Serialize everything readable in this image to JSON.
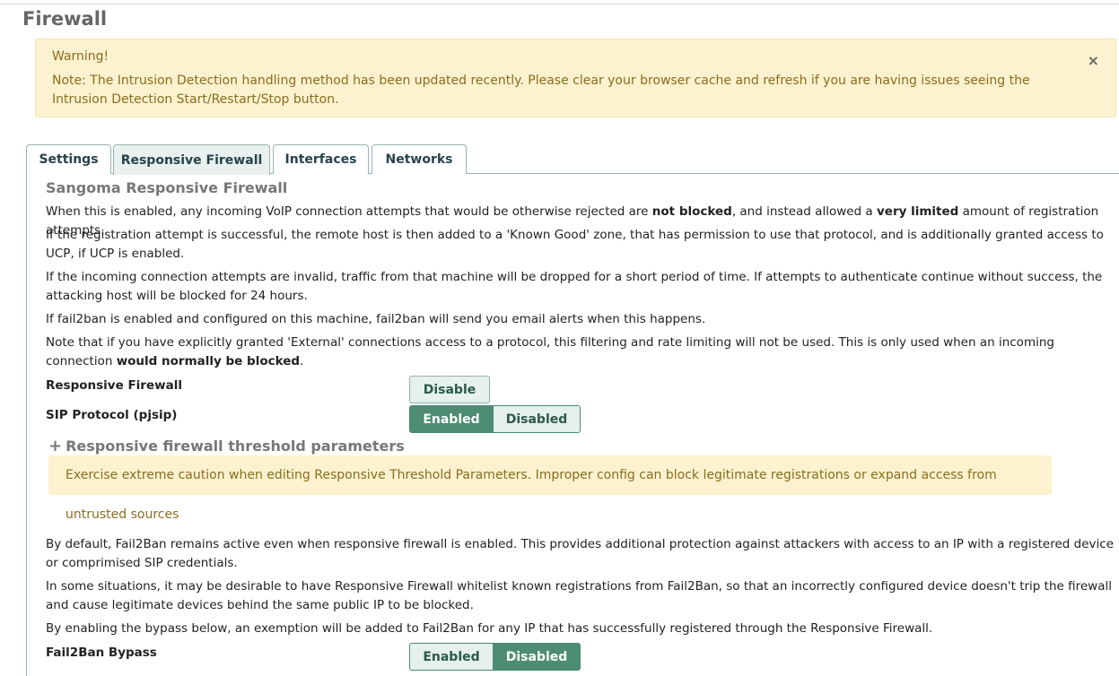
{
  "page": {
    "title": "Firewall"
  },
  "warning": {
    "title": "Warning!",
    "body": "Note: The Intrusion Detection handling method has been updated recently. Please clear your browser cache and refresh if you are having issues seeing the Intrusion Detection Start/Restart/Stop button.",
    "close": "×"
  },
  "tabs": [
    {
      "label": "Settings"
    },
    {
      "label": "Responsive Firewall"
    },
    {
      "label": "Interfaces"
    },
    {
      "label": "Networks"
    }
  ],
  "section": {
    "title": "Sangoma Responsive Firewall",
    "p1_a": "When this is enabled, any incoming VoIP connection attempts that would be otherwise rejected are ",
    "p1_b": "not blocked",
    "p1_c": ", and instead allowed a ",
    "p1_d": "very limited",
    "p1_e": " amount of registration attempts.",
    "p2": "If the registration attempt is successful, the remote host is then added to a 'Known Good' zone, that has permission to use that protocol, and is additionally granted access to UCP, if UCP is enabled.",
    "p3": "If the incoming connection attempts are invalid, traffic from that machine will be dropped for a short period of time. If attempts to authenticate continue without success, the attacking host will be blocked for 24 hours.",
    "p4": "If fail2ban is enabled and configured on this machine, fail2ban will send you email alerts when this happens.",
    "p5_a": "Note that if you have explicitly granted 'External' connections access to a protocol, this filtering and rate limiting will not be used. This is only used when an incoming connection ",
    "p5_b": "would normally be blocked",
    "p5_c": "."
  },
  "responsive_firewall": {
    "label": "Responsive Firewall",
    "button": "Disable"
  },
  "sip_protocol": {
    "label": "SIP Protocol (pjsip)",
    "enabled": "Enabled",
    "disabled": "Disabled"
  },
  "threshold": {
    "title": "Responsive firewall threshold parameters",
    "plus": "+",
    "caution": "Exercise extreme caution when editing Responsive Threshold Parameters. Improper config can block legitimate registrations or expand access from untrusted sources"
  },
  "fail2ban": {
    "p1": "By default, Fail2Ban remains active even when responsive firewall is enabled. This provides additional protection against attackers with access to an IP with a registered device or comprimised SIP credentials.",
    "p2": "In some situations, it may be desirable to have Responsive Firewall whitelist known registrations from Fail2Ban, so that an incorrectly configured device doesn't trip the firewall and cause legitimate devices behind the same public IP to be blocked.",
    "p3": "By enabling the bypass below, an exemption will be added to Fail2Ban for any IP that has successfully registered through the Responsive Firewall.",
    "label": "Fail2Ban Bypass",
    "enabled": "Enabled",
    "disabled": "Disabled"
  },
  "colors": {
    "accent": "#4e8d73",
    "warning_bg": "#fcf2cf",
    "warning_text": "#8a6d1e"
  }
}
